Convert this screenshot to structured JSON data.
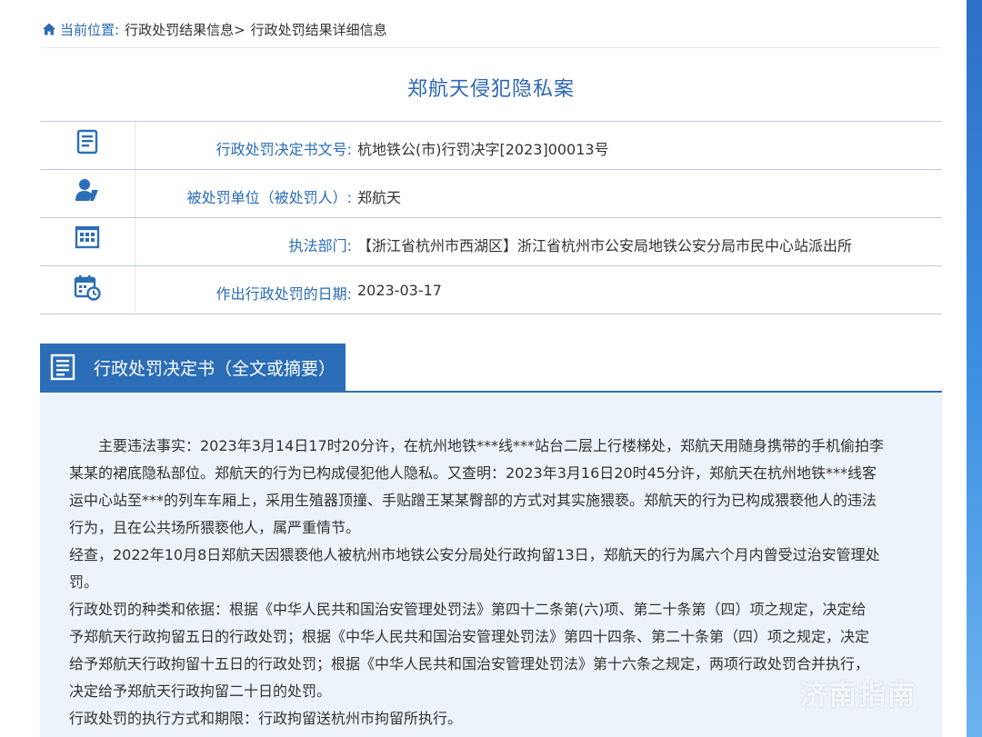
{
  "breadcrumb": {
    "label": "当前位置:",
    "items": [
      "行政处罚结果信息>",
      "行政处罚结果详细信息"
    ]
  },
  "title": "郑航天侵犯隐私案",
  "info": [
    {
      "icon": "document-list-icon",
      "label": "行政处罚决定书文号:",
      "value": "杭地铁公(市)行罚决字[2023]00013号"
    },
    {
      "icon": "person-icon",
      "label": "被处罚单位（被处罚人）:",
      "value": "郑航天"
    },
    {
      "icon": "building-icon",
      "label": "执法部门:",
      "value": "【浙江省杭州市西湖区】浙江省杭州市公安局地铁公安分局市民中心站派出所"
    },
    {
      "icon": "calendar-clock-icon",
      "label": "作出行政处罚的日期:",
      "value": "2023-03-17"
    }
  ],
  "section": {
    "title": "行政处罚决定书（全文或摘要）"
  },
  "content": {
    "lines": [
      "　　主要违法事实：2023年3月14日17时20分许，在杭州地铁***线***站台二层上行楼梯处，郑航天用随身携带的手机偷拍李",
      "某某的裙底隐私部位。郑航天的行为已构成侵犯他人隐私。又查明：2023年3月16日20时45分许，郑航天在杭州地铁***线客",
      "运中心站至***的列车车厢上，采用生殖器顶撞、手贴蹭王某某臀部的方式对其实施猥亵。郑航天的行为已构成猥亵他人的违法",
      "行为，且在公共场所猥亵他人，属严重情节。",
      "经查，2022年10月8日郑航天因猥亵他人被杭州市地铁公安分局处行政拘留13日，郑航天的行为属六个月内曾受过治安管理处",
      "罚。",
      "行政处罚的种类和依据：根据《中华人民共和国治安管理处罚法》第四十二条第(六)项、第二十条第（四）项之规定，决定给",
      "予郑航天行政拘留五日的行政处罚；根据《中华人民共和国治安管理处罚法》第四十四条、第二十条第（四）项之规定，决定",
      "给予郑航天行政拘留十五日的行政处罚；根据《中华人民共和国治安管理处罚法》第十六条之规定，两项行政处罚合并执行，",
      "决定给予郑航天行政拘留二十日的处罚。",
      "行政处罚的执行方式和期限：行政拘留送杭州市拘留所执行。"
    ]
  },
  "watermark": "济南指南",
  "colors": {
    "accent": "#2c6db8",
    "label_blue": "#2a6bb8",
    "content_bg": "#edf3fa"
  }
}
